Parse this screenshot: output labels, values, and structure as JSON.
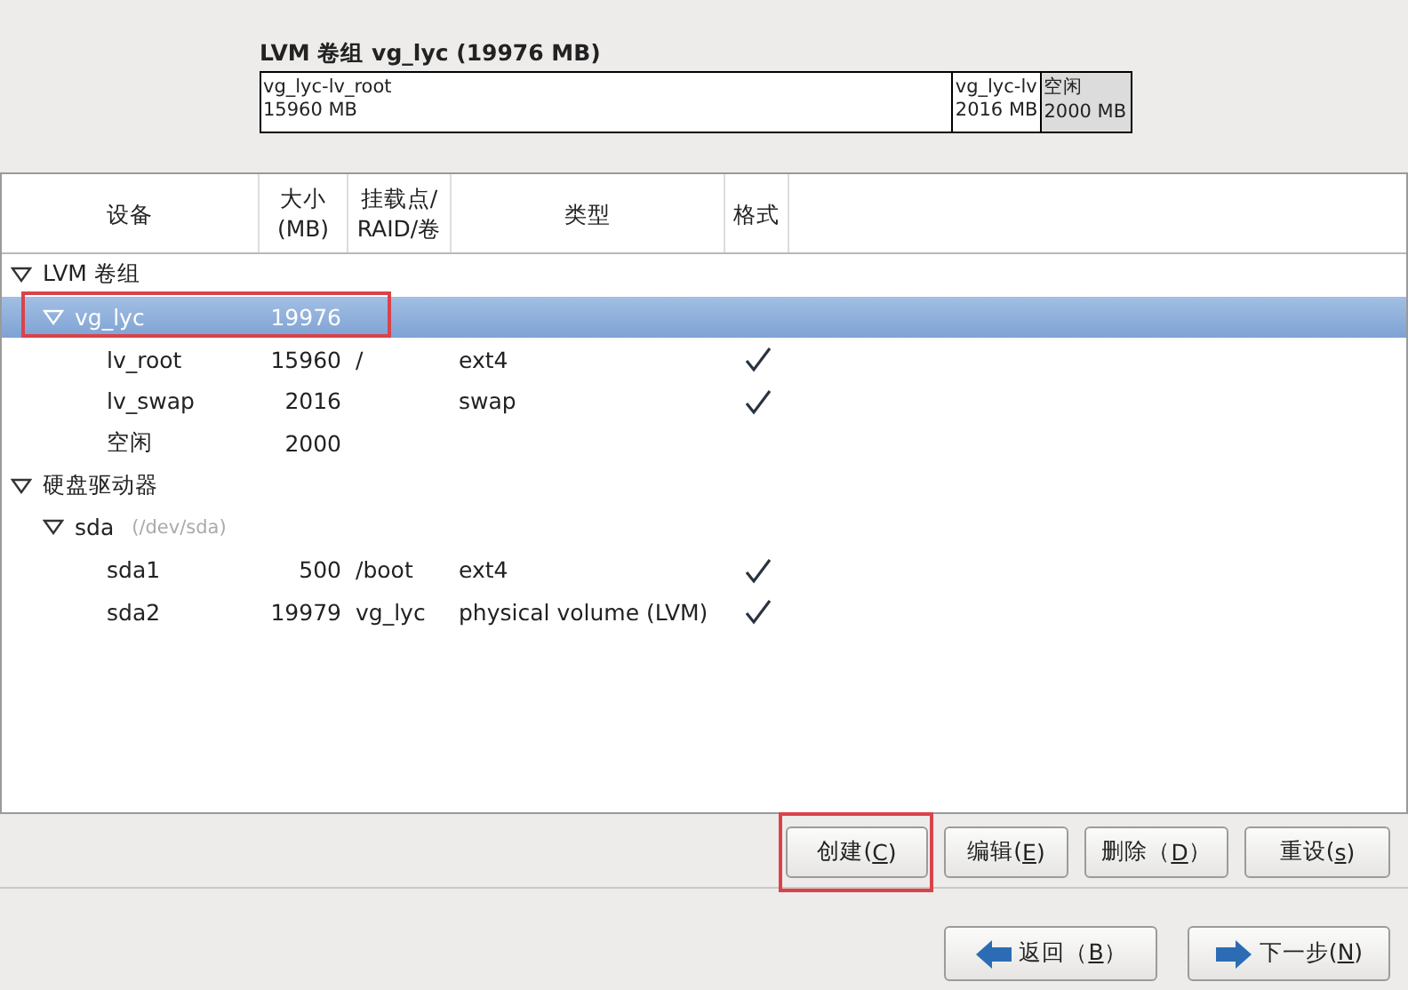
{
  "volume_group": {
    "title": "LVM 卷组 vg_lyc (19976 MB)",
    "segments": [
      {
        "name": "vg_lyc-lv_root",
        "size": "15960 MB",
        "free": false
      },
      {
        "name": "vg_lyc-lv",
        "size": "2016 MB",
        "free": false
      },
      {
        "name": "空闲",
        "size": "2000 MB",
        "free": true
      }
    ]
  },
  "table": {
    "columns": [
      "设备",
      "大小\n(MB)",
      "挂载点/\nRAID/卷",
      "类型",
      "格式"
    ],
    "rows": [
      {
        "device": "LVM 卷组",
        "expanded": true,
        "selected": false,
        "highlighted": false,
        "children": [
          {
            "device": "vg_lyc",
            "size": "19976",
            "expanded": true,
            "selected": true,
            "highlighted": true,
            "children": [
              {
                "device": "lv_root",
                "size": "15960",
                "mount": "/",
                "type": "ext4",
                "format": true,
                "selected": false,
                "highlighted": false
              },
              {
                "device": "lv_swap",
                "size": "2016",
                "type": "swap",
                "format": true,
                "selected": false,
                "highlighted": false
              },
              {
                "device": "空闲",
                "size": "2000",
                "format": false,
                "selected": false,
                "highlighted": false
              }
            ]
          }
        ]
      },
      {
        "device": "硬盘驱动器",
        "expanded": true,
        "selected": false,
        "highlighted": false,
        "children": [
          {
            "device": "sda",
            "note": "(/dev/sda)",
            "expanded": true,
            "selected": false,
            "highlighted": false,
            "children": [
              {
                "device": "sda1",
                "size": "500",
                "mount": "/boot",
                "type": "ext4",
                "format": true,
                "selected": false,
                "highlighted": false
              },
              {
                "device": "sda2",
                "size": "19979",
                "mount": "vg_lyc",
                "type": "physical volume (LVM)",
                "format": true,
                "selected": false,
                "highlighted": false
              }
            ]
          }
        ]
      }
    ]
  },
  "actions": [
    {
      "before": "创建(",
      "key": "C",
      "after": ")",
      "highlighted": true
    },
    {
      "before": "编辑(",
      "key": "E",
      "after": ")",
      "highlighted": false
    },
    {
      "before": "删除（",
      "key": "D",
      "after": "）",
      "highlighted": false
    },
    {
      "before": "重设(",
      "key": "s",
      "after": ")",
      "highlighted": false
    }
  ],
  "navigation": [
    {
      "kind": "back",
      "before": "返回（",
      "key": "B",
      "after": "）"
    },
    {
      "kind": "next",
      "before": "下一步(",
      "key": "N",
      "after": ")"
    }
  ]
}
